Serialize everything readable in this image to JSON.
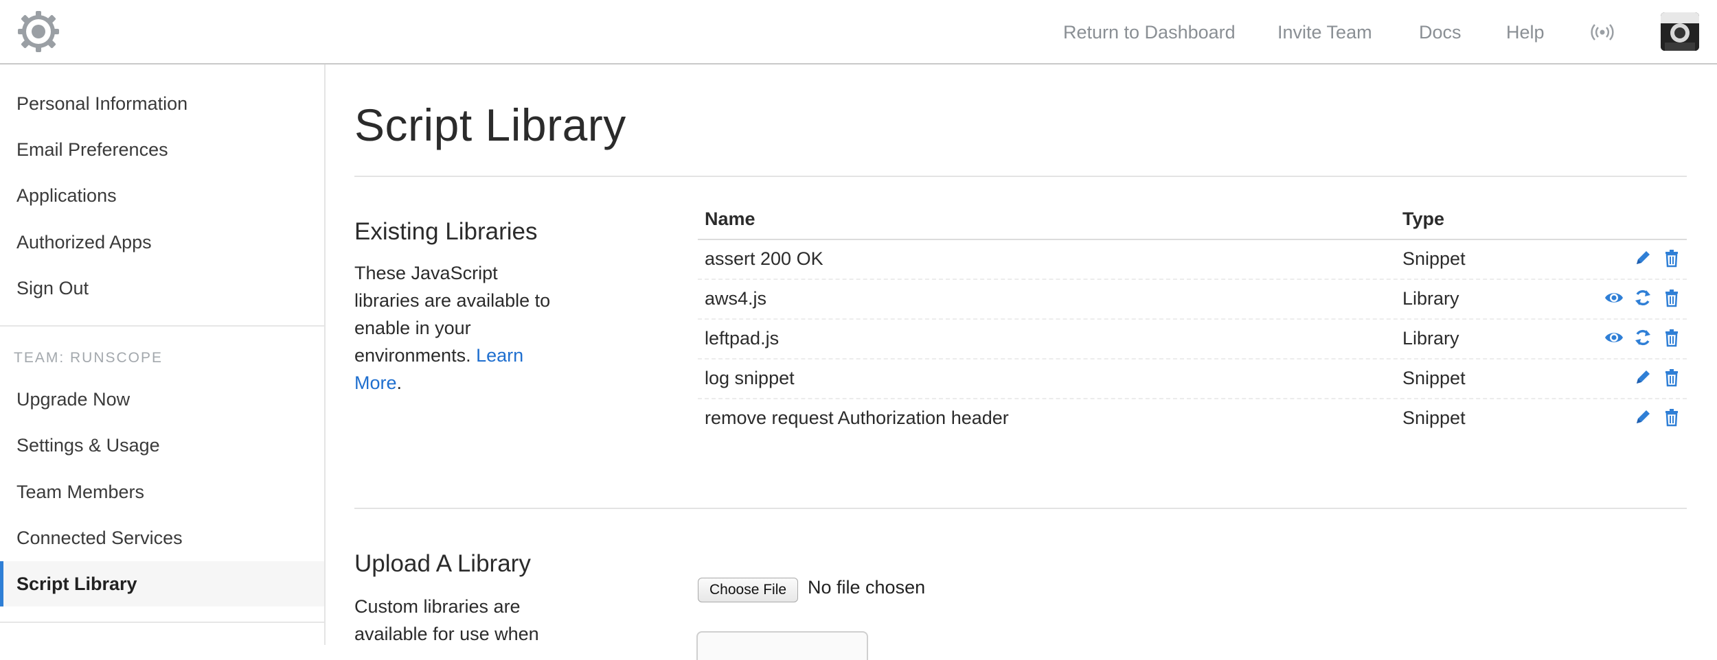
{
  "header": {
    "nav": [
      "Return to Dashboard",
      "Invite Team",
      "Docs",
      "Help"
    ],
    "logo_icon": "gear-icon",
    "broadcast_icon": "broadcast-icon",
    "accent": "#2f7fd6"
  },
  "sidebar": {
    "personal_items": [
      "Personal Information",
      "Email Preferences",
      "Applications",
      "Authorized Apps",
      "Sign Out"
    ],
    "team_label": "TEAM: RUNSCOPE",
    "team_items": [
      "Upgrade Now",
      "Settings & Usage",
      "Team Members",
      "Connected Services",
      "Script Library"
    ],
    "active_item": "Script Library"
  },
  "main": {
    "title": "Script Library",
    "existing": {
      "title": "Existing Libraries",
      "description": "These JavaScript libraries are available to enable in your environments.",
      "learn_more": "Learn More",
      "period": "."
    },
    "table": {
      "headers": {
        "name": "Name",
        "type": "Type"
      },
      "rows": [
        {
          "name": "assert 200 OK",
          "type": "Snippet",
          "actions": [
            "edit",
            "delete"
          ]
        },
        {
          "name": "aws4.js",
          "type": "Library",
          "actions": [
            "view",
            "refresh",
            "delete"
          ]
        },
        {
          "name": "leftpad.js",
          "type": "Library",
          "actions": [
            "view",
            "refresh",
            "delete"
          ]
        },
        {
          "name": "log snippet",
          "type": "Snippet",
          "actions": [
            "edit",
            "delete"
          ]
        },
        {
          "name": "remove request Authorization header",
          "type": "Snippet",
          "actions": [
            "edit",
            "delete"
          ]
        }
      ]
    },
    "upload": {
      "title": "Upload A Library",
      "description": "Custom libraries are available for use when",
      "choose_file": "Choose File",
      "no_file": "No file chosen"
    }
  }
}
